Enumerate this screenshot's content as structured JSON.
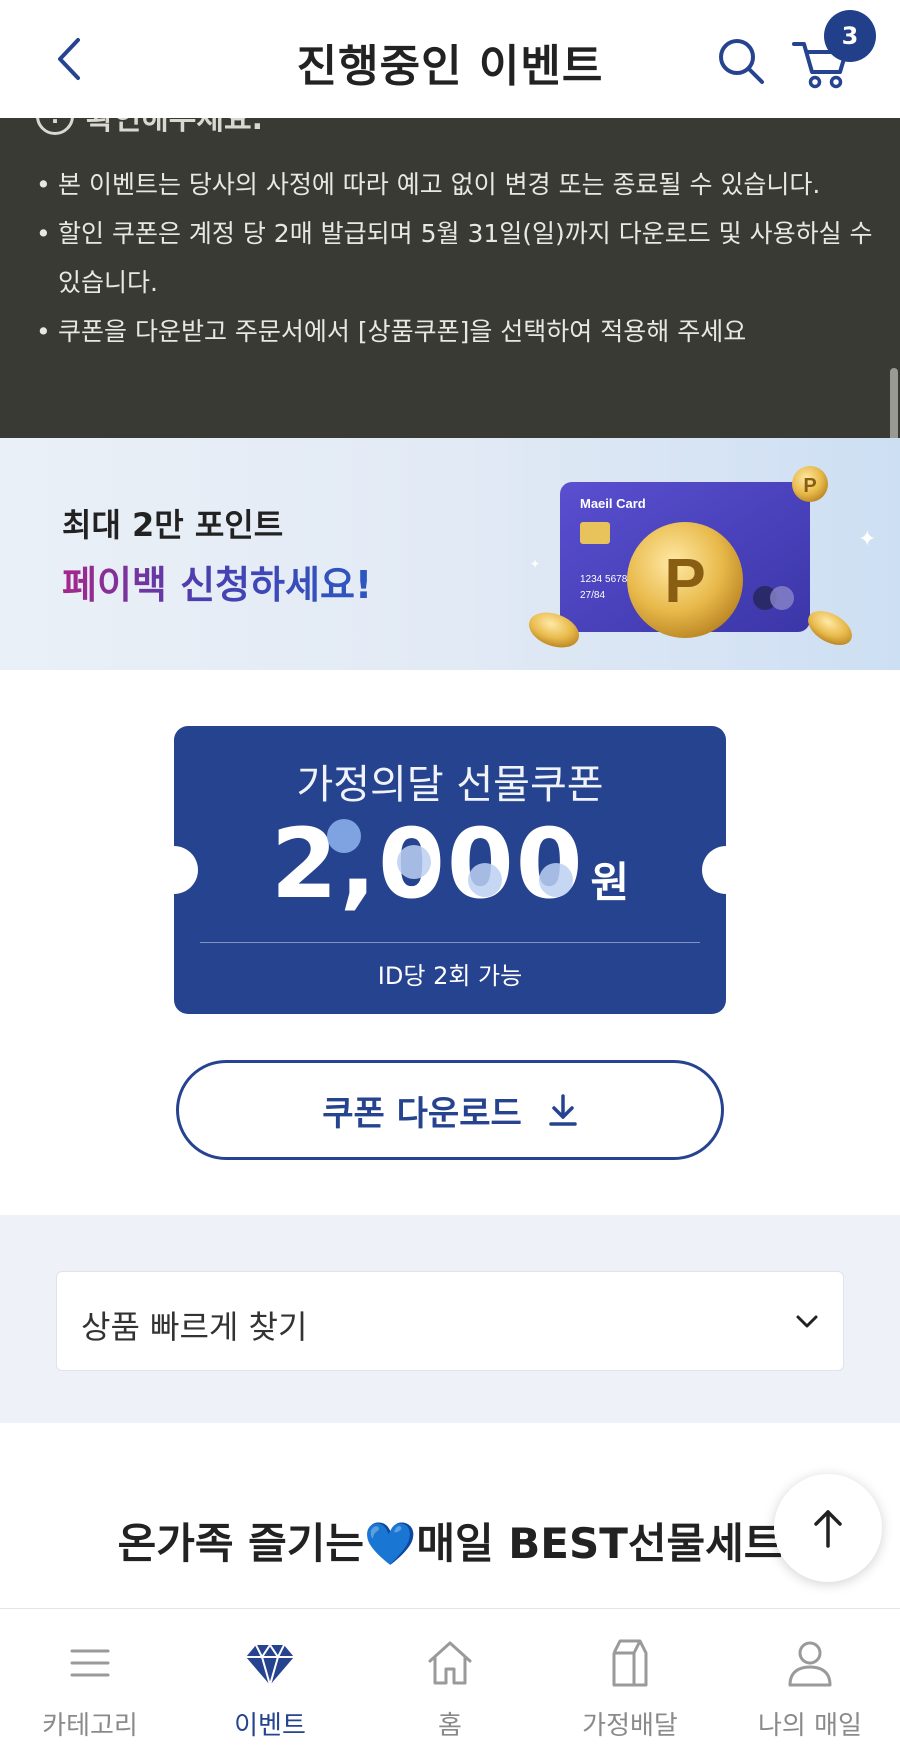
{
  "header": {
    "title": "진행중인 이벤트",
    "cart_count": "3"
  },
  "notice": {
    "heading": "확인해주세요.",
    "items": [
      "본 이벤트는 당사의 사정에 따라 예고 없이 변경 또는 종료될 수 있습니다.",
      "할인 쿠폰은 계정 당 2매 발급되며 5월 31일(일)까지 다운로드 및 사용하실 수 있습니다.",
      "쿠폰을 다운받고 주문서에서 [상품쿠폰]을 선택하여 적용해 주세요"
    ]
  },
  "banner": {
    "line1": "최대 2만 포인트",
    "line2": "페이백 신청하세요!",
    "card_brand": "Maeil Card",
    "card_number": "1234 5678",
    "card_expiry": "27/84",
    "coin_letter": "P"
  },
  "coupon": {
    "title": "가정의달 선물쿠폰",
    "amount": "2,000",
    "unit": "원",
    "limit": "ID당 2회 가능"
  },
  "download_button": {
    "label": "쿠폰 다운로드"
  },
  "quick_find": {
    "label": "상품 빠르게 찾기"
  },
  "best": {
    "title_before": "온가족 즐기는",
    "heart": "💙",
    "title_after": "매일 BEST선물세트"
  },
  "nav": {
    "items": [
      {
        "label": "카테고리"
      },
      {
        "label": "이벤트"
      },
      {
        "label": "홈"
      },
      {
        "label": "가정배달"
      },
      {
        "label": "나의 매일"
      }
    ]
  },
  "colors": {
    "brand_navy": "#26438f",
    "notice_bg": "#3a3a34",
    "section_bg": "#eef2f8"
  }
}
